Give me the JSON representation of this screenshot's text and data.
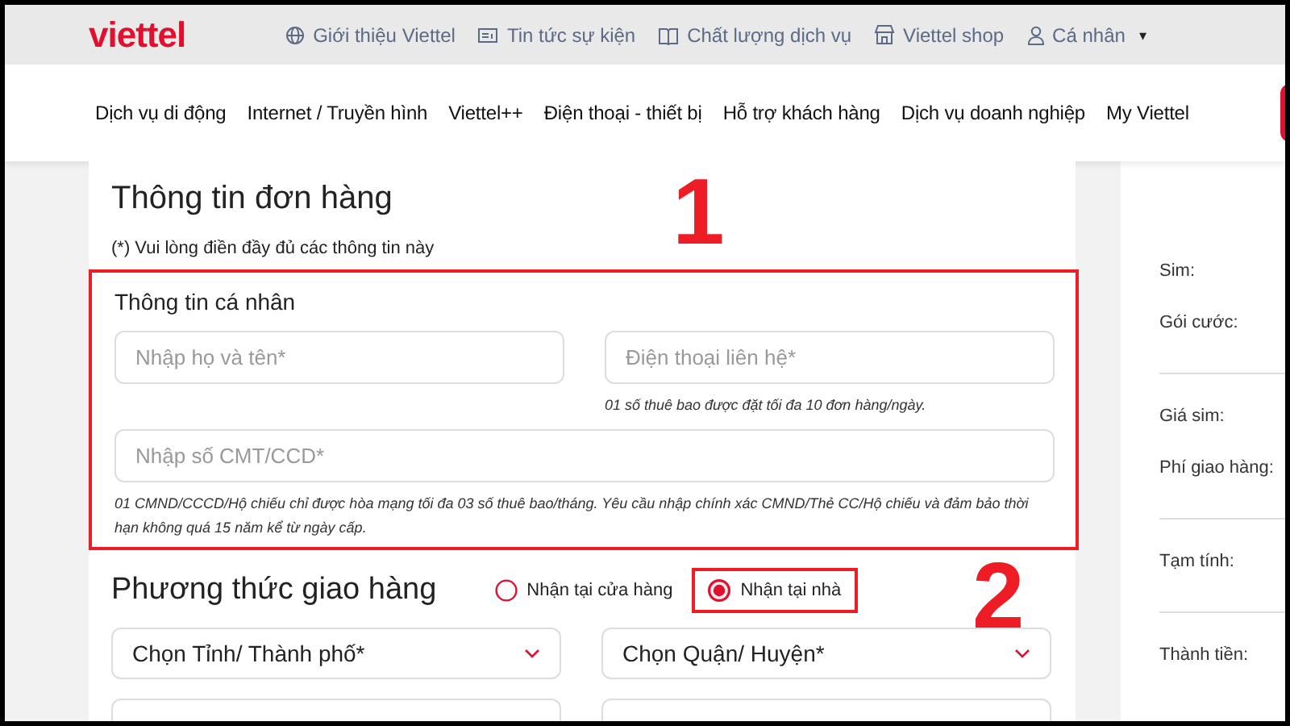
{
  "header": {
    "logo": "viettel",
    "links": [
      {
        "label": "Giới thiệu Viettel"
      },
      {
        "label": "Tin tức sự kiện"
      },
      {
        "label": "Chất lượng dịch vụ"
      },
      {
        "label": "Viettel shop"
      },
      {
        "label": "Cá nhân",
        "caret": "▾"
      }
    ]
  },
  "nav": [
    "Dịch vụ di động",
    "Internet / Truyền hình",
    "Viettel++",
    "Điện thoại - thiết bị",
    "Hỗ trợ khách hàng",
    "Dịch vụ doanh nghiệp",
    "My Viettel"
  ],
  "order": {
    "title": "Thông tin đơn hàng",
    "note": "(*) Vui lòng điền đầy đủ các thông tin này",
    "personal": {
      "title": "Thông tin cá nhân",
      "highlighted": true,
      "annotation": "1",
      "name_field": {
        "placeholder": "Nhập họ và tên*"
      },
      "phone_field": {
        "placeholder": "Điện thoại liên hệ*"
      },
      "phone_hint": "01 số thuê bao được đặt tối đa 10 đơn hàng/ngày.",
      "id_field": {
        "placeholder": "Nhập số CMT/CCD*"
      },
      "id_hint": "01 CMND/CCCD/Hộ chiếu chỉ được hòa mạng tối đa 03 số thuê bao/tháng. Yêu cầu nhập chính xác CMND/Thẻ CC/Hộ chiếu và đảm bảo thời hạn không quá 15 năm kể từ ngày cấp."
    },
    "delivery": {
      "title": "Phương thức giao hàng",
      "annotation": "2",
      "options": [
        {
          "label": "Nhận tại cửa hàng",
          "selected": false,
          "highlighted": false
        },
        {
          "label": "Nhận tại nhà",
          "selected": true,
          "highlighted": true
        }
      ],
      "selects": [
        "Chọn Tỉnh/ Thành phố*",
        "Chọn Quận/ Huyện*"
      ]
    }
  },
  "summary": [
    [
      "Sim:",
      "Gói cước:"
    ],
    [
      "Giá sim:",
      "Phí giao hàng:"
    ],
    [
      "Tạm tính:"
    ],
    [
      "Thành tiền:"
    ]
  ]
}
